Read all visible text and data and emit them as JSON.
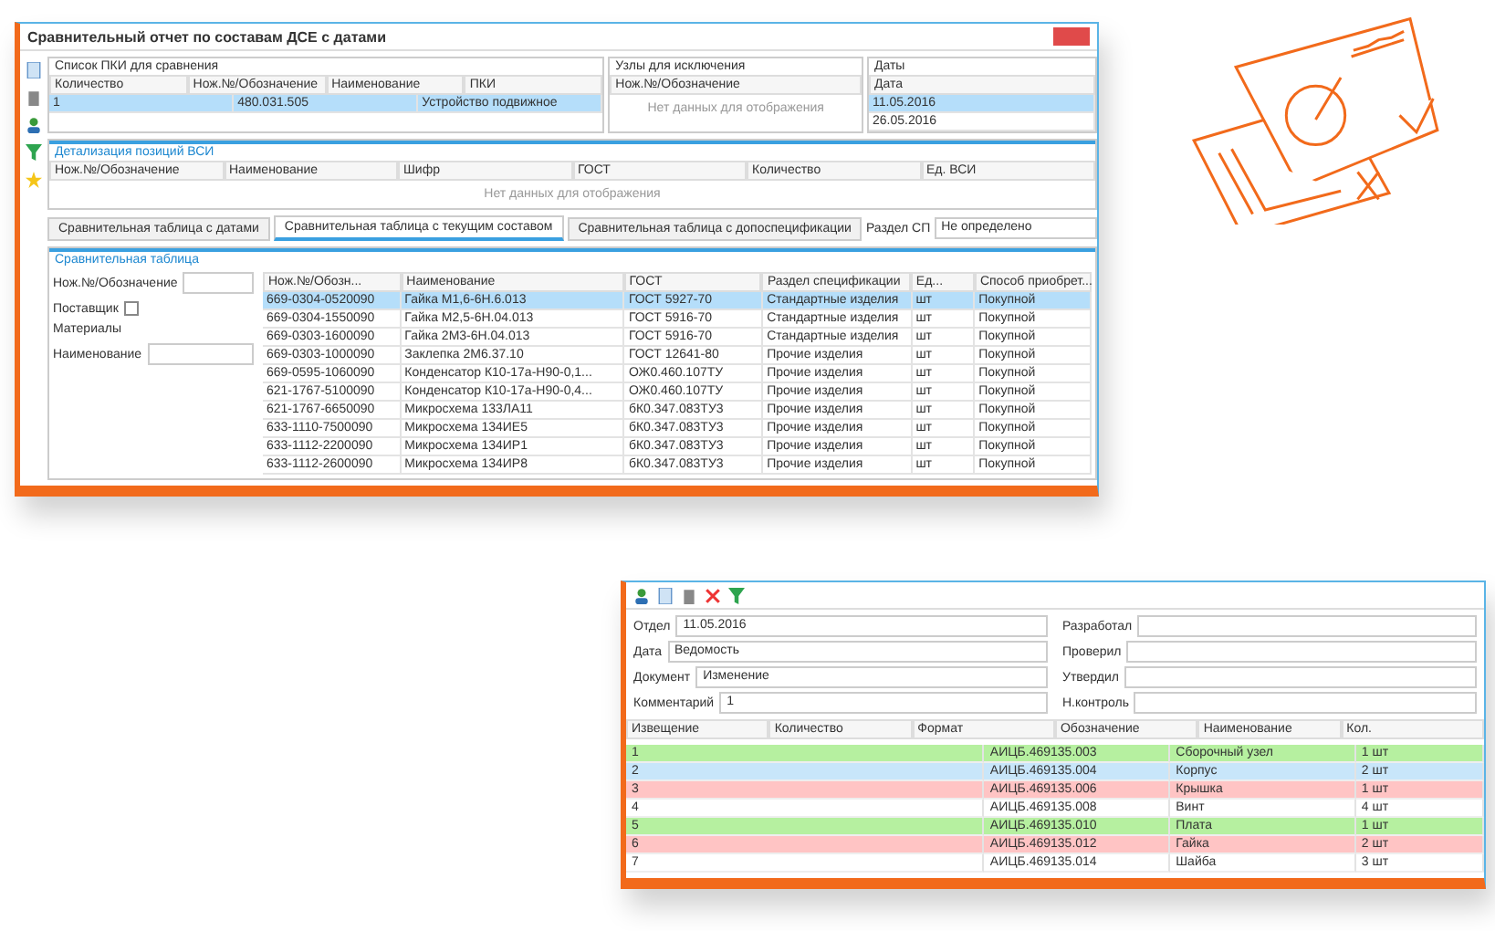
{
  "main_window": {
    "title": "Сравнительный отчет по составам ДСЕ с датами",
    "pki_panel": {
      "title": "Список ПКИ для сравнения",
      "columns": [
        "Количество",
        "Нож.№/Обозначение",
        "Наименование",
        "ПКИ"
      ],
      "row": [
        "1",
        "480.031.505",
        "Устройство подвижное"
      ]
    },
    "exclude_panel": {
      "title": "Узлы для исключения",
      "column": "Нож.№/Обозначение",
      "empty": "Нет данных для отображения"
    },
    "dates_panel": {
      "title": "Даты",
      "column": "Дата",
      "dates": [
        {
          "value": "11.05.2016",
          "selected": true
        },
        {
          "value": "26.05.2016",
          "selected": false
        }
      ]
    },
    "detail_panel": {
      "title": "Детализация позиций ВСИ",
      "columns": [
        "Нож.№/Обозначение",
        "Наименование",
        "Шифр",
        "ГОСТ",
        "Количество",
        "Ед. ВСИ"
      ],
      "empty": "Нет данных для отображения"
    },
    "tabs": [
      {
        "label": "Сравнительная таблица с датами",
        "selected": false
      },
      {
        "label": "Сравнительная таблица с текущим составом",
        "selected": true
      },
      {
        "label": "Сравнительная таблица с допоспецификации",
        "selected": false
      }
    ],
    "section_field": {
      "label": "Раздел СП",
      "value": "Не определено"
    },
    "compare_panel": {
      "title": "Сравнительная таблица",
      "filters": [
        {
          "label": "Нож.№/Обозначение",
          "kind": "text"
        },
        {
          "label": "Поставщик",
          "kind": "checkbox",
          "checked": false
        },
        {
          "label": "Материалы",
          "kind": "none"
        }
      ],
      "name_label": "Наименование",
      "columns": [
        "Нож.№/Обозн...",
        "Наименование",
        "ГОСТ",
        "Раздел спецификации",
        "Ед...",
        "Способ приобрет..."
      ],
      "rows": [
        {
          "cells": [
            "669-0304-0520090",
            "Гайка М1,6-6Н.6.013",
            "ГОСТ 5927-70",
            "Стандартные изделия",
            "шт",
            "Покупной"
          ],
          "selected": true
        },
        {
          "cells": [
            "669-0304-1550090",
            "Гайка М2,5-6Н.04.013",
            "ГОСТ 5916-70",
            "Стандартные изделия",
            "шт",
            "Покупной"
          ],
          "selected": false
        },
        {
          "cells": [
            "669-0303-1600090",
            "Гайка 2М3-6Н.04.013",
            "ГОСТ 5916-70",
            "Стандартные изделия",
            "шт",
            "Покупной"
          ],
          "selected": false
        },
        {
          "cells": [
            "669-0303-1000090",
            "Заклепка 2М6.37.10",
            "ГОСТ 12641-80",
            "Прочие изделия",
            "шт",
            "Покупной"
          ],
          "selected": false
        },
        {
          "cells": [
            "669-0595-1060090",
            "Конденсатор К10-17а-Н90-0,1...",
            "ОЖ0.460.107ТУ",
            "Прочие изделия",
            "шт",
            "Покупной"
          ],
          "selected": false
        },
        {
          "cells": [
            "621-1767-5100090",
            "Конденсатор К10-17а-Н90-0,4...",
            "ОЖ0.460.107ТУ",
            "Прочие изделия",
            "шт",
            "Покупной"
          ],
          "selected": false
        },
        {
          "cells": [
            "621-1767-6650090",
            "Микросхема 133ЛА11",
            "бК0.347.083ТУ3",
            "Прочие изделия",
            "шт",
            "Покупной"
          ],
          "selected": false
        },
        {
          "cells": [
            "633-1110-7500090",
            "Микросхема 134ИЕ5",
            "бК0.347.083ТУ3",
            "Прочие изделия",
            "шт",
            "Покупной"
          ],
          "selected": false
        },
        {
          "cells": [
            "633-1112-2200090",
            "Микросхема 134ИР1",
            "бК0.347.083ТУ3",
            "Прочие изделия",
            "шт",
            "Покупной"
          ],
          "selected": false
        },
        {
          "cells": [
            "633-1112-2600090",
            "Микросхема 134ИР8",
            "бК0.347.083ТУ3",
            "Прочие изделия",
            "шт",
            "Покупной"
          ],
          "selected": false
        }
      ]
    }
  },
  "second_window": {
    "fields": [
      {
        "label": "Отдел",
        "value": "11.05.2016"
      },
      {
        "label": "Дата",
        "value": "Ведомость"
      },
      {
        "label": "Документ",
        "value": "Изменение"
      },
      {
        "label": "Комментарий",
        "value": "1"
      }
    ],
    "side_fields": [
      {
        "label": "Разработал"
      },
      {
        "label": "Проверил"
      },
      {
        "label": "Утвердил"
      },
      {
        "label": "Н.контроль"
      }
    ],
    "grid_columns": [
      "Извещение",
      "Количество",
      "Формат",
      "Обозначение",
      "Наименование",
      "Кол."
    ],
    "grid_rows": [
      {
        "kind": "added",
        "cells": [
          "1",
          "АИЦБ.469135.003",
          "Сборочный узел",
          "1 шт"
        ]
      },
      {
        "kind": "changed",
        "cells": [
          "2",
          "АИЦБ.469135.004",
          "Корпус",
          "2 шт"
        ]
      },
      {
        "kind": "removed",
        "cells": [
          "3",
          "АИЦБ.469135.006",
          "Крышка",
          "1 шт"
        ]
      },
      {
        "kind": "same",
        "cells": [
          "4",
          "АИЦБ.469135.008",
          "Винт",
          "4 шт"
        ]
      },
      {
        "kind": "added",
        "cells": [
          "5",
          "АИЦБ.469135.010",
          "Плата",
          "1 шт"
        ]
      },
      {
        "kind": "removed",
        "cells": [
          "6",
          "АИЦБ.469135.012",
          "Гайка",
          "2 шт"
        ]
      },
      {
        "kind": "same",
        "cells": [
          "7",
          "АИЦБ.469135.014",
          "Шайба",
          "3 шт"
        ]
      }
    ]
  }
}
